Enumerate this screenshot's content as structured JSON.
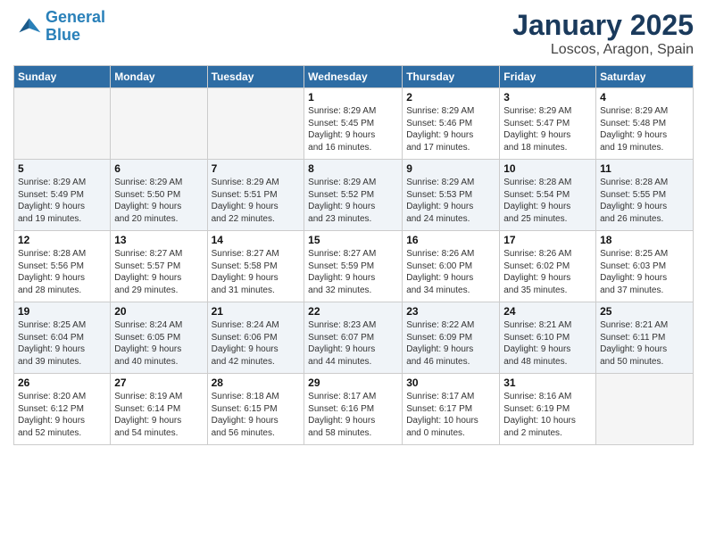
{
  "header": {
    "logo_line1": "General",
    "logo_line2": "Blue",
    "title": "January 2025",
    "subtitle": "Loscos, Aragon, Spain"
  },
  "weekdays": [
    "Sunday",
    "Monday",
    "Tuesday",
    "Wednesday",
    "Thursday",
    "Friday",
    "Saturday"
  ],
  "weeks": [
    [
      {
        "num": "",
        "info": ""
      },
      {
        "num": "",
        "info": ""
      },
      {
        "num": "",
        "info": ""
      },
      {
        "num": "1",
        "info": "Sunrise: 8:29 AM\nSunset: 5:45 PM\nDaylight: 9 hours\nand 16 minutes."
      },
      {
        "num": "2",
        "info": "Sunrise: 8:29 AM\nSunset: 5:46 PM\nDaylight: 9 hours\nand 17 minutes."
      },
      {
        "num": "3",
        "info": "Sunrise: 8:29 AM\nSunset: 5:47 PM\nDaylight: 9 hours\nand 18 minutes."
      },
      {
        "num": "4",
        "info": "Sunrise: 8:29 AM\nSunset: 5:48 PM\nDaylight: 9 hours\nand 19 minutes."
      }
    ],
    [
      {
        "num": "5",
        "info": "Sunrise: 8:29 AM\nSunset: 5:49 PM\nDaylight: 9 hours\nand 19 minutes."
      },
      {
        "num": "6",
        "info": "Sunrise: 8:29 AM\nSunset: 5:50 PM\nDaylight: 9 hours\nand 20 minutes."
      },
      {
        "num": "7",
        "info": "Sunrise: 8:29 AM\nSunset: 5:51 PM\nDaylight: 9 hours\nand 22 minutes."
      },
      {
        "num": "8",
        "info": "Sunrise: 8:29 AM\nSunset: 5:52 PM\nDaylight: 9 hours\nand 23 minutes."
      },
      {
        "num": "9",
        "info": "Sunrise: 8:29 AM\nSunset: 5:53 PM\nDaylight: 9 hours\nand 24 minutes."
      },
      {
        "num": "10",
        "info": "Sunrise: 8:28 AM\nSunset: 5:54 PM\nDaylight: 9 hours\nand 25 minutes."
      },
      {
        "num": "11",
        "info": "Sunrise: 8:28 AM\nSunset: 5:55 PM\nDaylight: 9 hours\nand 26 minutes."
      }
    ],
    [
      {
        "num": "12",
        "info": "Sunrise: 8:28 AM\nSunset: 5:56 PM\nDaylight: 9 hours\nand 28 minutes."
      },
      {
        "num": "13",
        "info": "Sunrise: 8:27 AM\nSunset: 5:57 PM\nDaylight: 9 hours\nand 29 minutes."
      },
      {
        "num": "14",
        "info": "Sunrise: 8:27 AM\nSunset: 5:58 PM\nDaylight: 9 hours\nand 31 minutes."
      },
      {
        "num": "15",
        "info": "Sunrise: 8:27 AM\nSunset: 5:59 PM\nDaylight: 9 hours\nand 32 minutes."
      },
      {
        "num": "16",
        "info": "Sunrise: 8:26 AM\nSunset: 6:00 PM\nDaylight: 9 hours\nand 34 minutes."
      },
      {
        "num": "17",
        "info": "Sunrise: 8:26 AM\nSunset: 6:02 PM\nDaylight: 9 hours\nand 35 minutes."
      },
      {
        "num": "18",
        "info": "Sunrise: 8:25 AM\nSunset: 6:03 PM\nDaylight: 9 hours\nand 37 minutes."
      }
    ],
    [
      {
        "num": "19",
        "info": "Sunrise: 8:25 AM\nSunset: 6:04 PM\nDaylight: 9 hours\nand 39 minutes."
      },
      {
        "num": "20",
        "info": "Sunrise: 8:24 AM\nSunset: 6:05 PM\nDaylight: 9 hours\nand 40 minutes."
      },
      {
        "num": "21",
        "info": "Sunrise: 8:24 AM\nSunset: 6:06 PM\nDaylight: 9 hours\nand 42 minutes."
      },
      {
        "num": "22",
        "info": "Sunrise: 8:23 AM\nSunset: 6:07 PM\nDaylight: 9 hours\nand 44 minutes."
      },
      {
        "num": "23",
        "info": "Sunrise: 8:22 AM\nSunset: 6:09 PM\nDaylight: 9 hours\nand 46 minutes."
      },
      {
        "num": "24",
        "info": "Sunrise: 8:21 AM\nSunset: 6:10 PM\nDaylight: 9 hours\nand 48 minutes."
      },
      {
        "num": "25",
        "info": "Sunrise: 8:21 AM\nSunset: 6:11 PM\nDaylight: 9 hours\nand 50 minutes."
      }
    ],
    [
      {
        "num": "26",
        "info": "Sunrise: 8:20 AM\nSunset: 6:12 PM\nDaylight: 9 hours\nand 52 minutes."
      },
      {
        "num": "27",
        "info": "Sunrise: 8:19 AM\nSunset: 6:14 PM\nDaylight: 9 hours\nand 54 minutes."
      },
      {
        "num": "28",
        "info": "Sunrise: 8:18 AM\nSunset: 6:15 PM\nDaylight: 9 hours\nand 56 minutes."
      },
      {
        "num": "29",
        "info": "Sunrise: 8:17 AM\nSunset: 6:16 PM\nDaylight: 9 hours\nand 58 minutes."
      },
      {
        "num": "30",
        "info": "Sunrise: 8:17 AM\nSunset: 6:17 PM\nDaylight: 10 hours\nand 0 minutes."
      },
      {
        "num": "31",
        "info": "Sunrise: 8:16 AM\nSunset: 6:19 PM\nDaylight: 10 hours\nand 2 minutes."
      },
      {
        "num": "",
        "info": ""
      }
    ]
  ]
}
